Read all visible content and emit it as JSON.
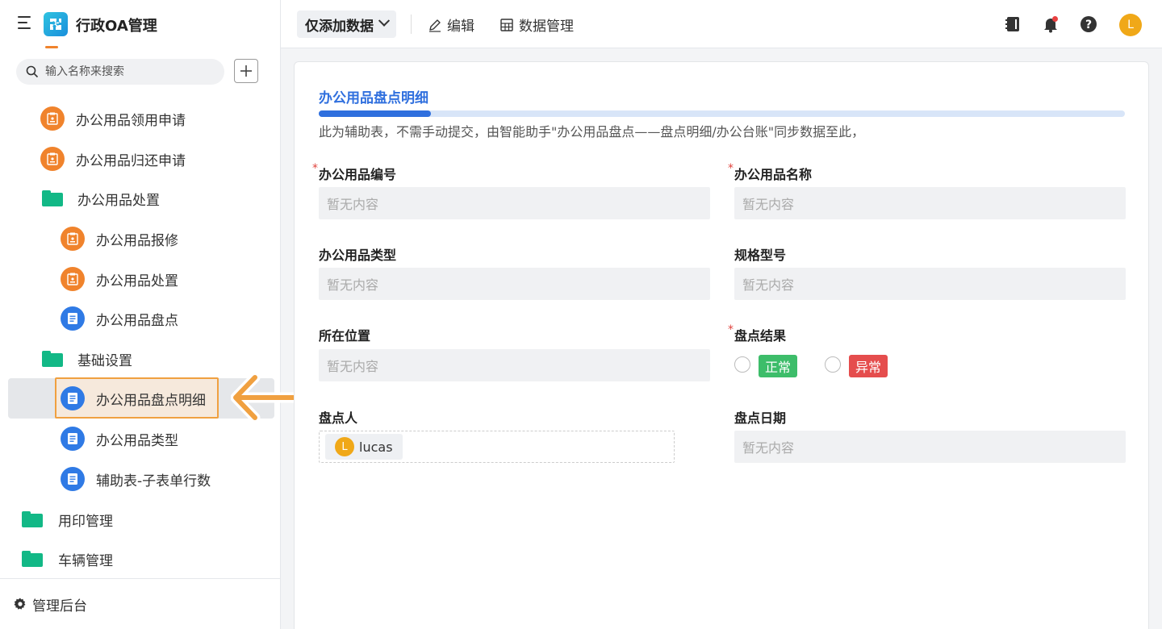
{
  "app": {
    "title": "行政OA管理"
  },
  "search": {
    "placeholder": "输入名称来搜索"
  },
  "sidebar": {
    "items": [
      {
        "label": "办公用品领用申请",
        "icon": "form-icon"
      },
      {
        "label": "办公用品归还申请",
        "icon": "form-icon"
      },
      {
        "label": "办公用品处置",
        "icon": "folder-icon"
      },
      {
        "label": "办公用品报修",
        "icon": "form-icon"
      },
      {
        "label": "办公用品处置",
        "icon": "form-icon"
      },
      {
        "label": "办公用品盘点",
        "icon": "document-icon"
      },
      {
        "label": "基础设置",
        "icon": "folder-icon"
      },
      {
        "label": "办公用品盘点明细",
        "icon": "document-icon",
        "active": true
      },
      {
        "label": "办公用品类型",
        "icon": "document-icon"
      },
      {
        "label": "辅助表-子表单行数",
        "icon": "document-icon"
      },
      {
        "label": "用印管理",
        "icon": "folder-icon"
      },
      {
        "label": "车辆管理",
        "icon": "folder-icon"
      }
    ],
    "footer": "管理后台"
  },
  "toolbar": {
    "view_select": "仅添加数据",
    "edit": "编辑",
    "data_manage": "数据管理",
    "avatar_initial": "L"
  },
  "form": {
    "section_title": "办公用品盘点明细",
    "section_desc": "此为辅助表，不需手动提交，由智能助手\"办公用品盘点——盘点明细/办公台账\"同步数据至此，",
    "empty_text": "暂无内容",
    "fields": {
      "item_code": {
        "label": "办公用品编号",
        "required": true
      },
      "item_name": {
        "label": "办公用品名称",
        "required": true
      },
      "item_type": {
        "label": "办公用品类型"
      },
      "spec_model": {
        "label": "规格型号"
      },
      "location": {
        "label": "所在位置"
      },
      "check_result": {
        "label": "盘点结果",
        "required": true,
        "options": [
          "正常",
          "异常"
        ]
      },
      "checker": {
        "label": "盘点人",
        "user": "lucas",
        "user_initial": "L"
      },
      "check_date": {
        "label": "盘点日期"
      }
    }
  },
  "colors": {
    "accent": "#2f6fde",
    "orange_icon": "#f0832c",
    "blue_icon": "#2f7ae5",
    "folder": "#12b886",
    "tag_normal": "#3dbd6a",
    "tag_abnormal": "#e54d4d",
    "highlight_arrow": "#f0a040"
  }
}
